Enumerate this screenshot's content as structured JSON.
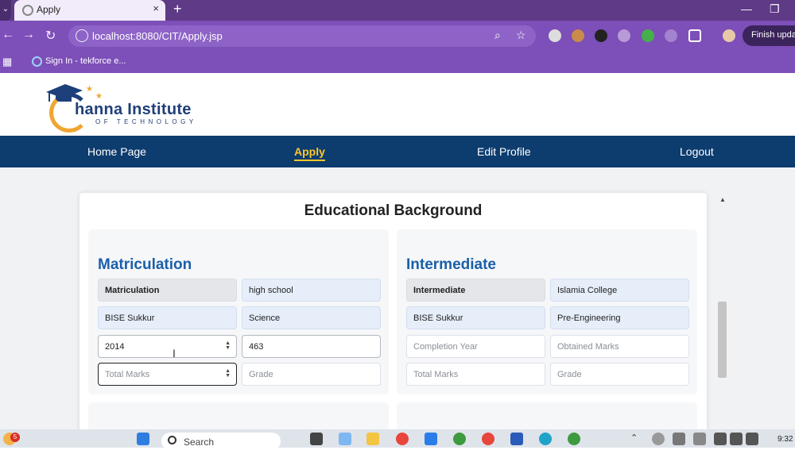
{
  "browser": {
    "tab_title": "Apply",
    "new_tab": "+",
    "close_tab": "×",
    "url": "localhost:8080/CIT/Apply.jsp",
    "update_label": "Finish update",
    "bookmark_label": "Sign In - tekforce e...",
    "minimize": "—",
    "restore": "❐"
  },
  "site": {
    "logo_name": "hanna Institute",
    "logo_sub": "OF TECHNOLOGY",
    "nav": [
      {
        "label": "Home Page"
      },
      {
        "label": "Apply"
      },
      {
        "label": "Edit Profile"
      },
      {
        "label": "Logout"
      }
    ]
  },
  "form": {
    "title": "Educational Background",
    "matric": {
      "heading": "Matriculation",
      "degree": "Matriculation",
      "institute": "high school",
      "board": "BISE Sukkur",
      "group": "Science",
      "year": "2014",
      "obtained": "463",
      "total_placeholder": "Total Marks",
      "grade_placeholder": "Grade"
    },
    "inter": {
      "heading": "Intermediate",
      "degree": "Intermediate",
      "institute": "Islamia College",
      "board": "BISE Sukkur",
      "group": "Pre-Engineering",
      "year_placeholder": "Completion Year",
      "obtained_placeholder": "Obtained Marks",
      "total_placeholder": "Total Marks",
      "grade_placeholder": "Grade"
    }
  },
  "taskbar": {
    "search_label": "Search",
    "time": "9:32",
    "notification_count": "5"
  }
}
